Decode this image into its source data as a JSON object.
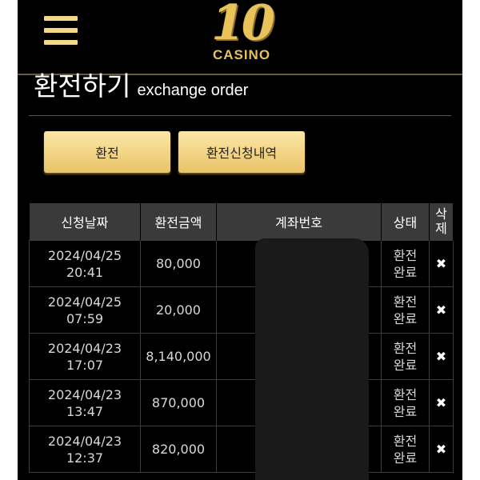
{
  "header": {
    "logo_number": "10",
    "logo_word": "CASINO"
  },
  "page": {
    "title_ko": "환전하기",
    "title_en": "exchange order"
  },
  "buttons": {
    "exchange": "환전",
    "history": "환전신청내역"
  },
  "table": {
    "headers": {
      "date": "신청날짜",
      "amount": "환전금액",
      "account": "계좌번호",
      "status": "상태",
      "delete_line1": "삭",
      "delete_line2": "제"
    },
    "rows": [
      {
        "date": "2024/04/25",
        "time": "20:41",
        "amount": "80,000",
        "status_line1": "환전",
        "status_line2": "완료",
        "delete": "✖"
      },
      {
        "date": "2024/04/25",
        "time": "07:59",
        "amount": "20,000",
        "status_line1": "환전",
        "status_line2": "완료",
        "delete": "✖"
      },
      {
        "date": "2024/04/23",
        "time": "17:07",
        "amount": "8,140,000",
        "status_line1": "환전",
        "status_line2": "완료",
        "delete": "✖"
      },
      {
        "date": "2024/04/23",
        "time": "13:47",
        "amount": "870,000",
        "status_line1": "환전",
        "status_line2": "완료",
        "delete": "✖"
      },
      {
        "date": "2024/04/23",
        "time": "12:37",
        "amount": "820,000",
        "status_line1": "환전",
        "status_line2": "완료",
        "delete": "✖"
      }
    ]
  },
  "colors": {
    "background": "#000000",
    "accent_gold": "#f3d586",
    "header_row": "#3a3a3a"
  }
}
